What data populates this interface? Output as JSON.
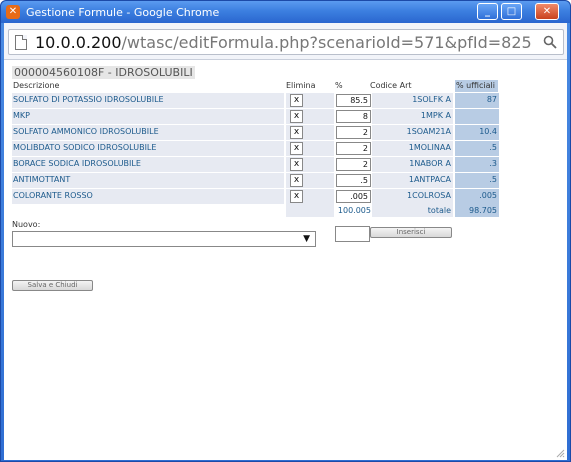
{
  "window": {
    "app_icon": "xampp-icon",
    "title": "Gestione Formule - Google Chrome",
    "minimize_label": "_",
    "maximize_label": "□",
    "close_label": "✕"
  },
  "address": {
    "host": "10.0.0.200",
    "path": "/wtasc/editFormula.php?scenarioId=571&pfId=825"
  },
  "formula": {
    "title": "000004560108F - IDROSOLUBILI",
    "headers": {
      "descrizione": "Descrizione",
      "elimina": "Elimina",
      "percent": "%",
      "codice_art": "Codice Art",
      "percent_ufficiali": "% ufficiali"
    },
    "rows": [
      {
        "descrizione": "SOLFATO DI POTASSIO IDROSOLUBILE",
        "elimina": "x",
        "percent": "85.5",
        "codice": "1SOLFK A",
        "ufficiali": "87"
      },
      {
        "descrizione": "MKP",
        "elimina": "x",
        "percent": "8",
        "codice": "1MPK A",
        "ufficiali": ""
      },
      {
        "descrizione": "SOLFATO AMMONICO IDROSOLUBILE",
        "elimina": "x",
        "percent": "2",
        "codice": "1SOAM21A",
        "ufficiali": "10.4"
      },
      {
        "descrizione": "MOLIBDATO SODICO IDROSOLUBILE",
        "elimina": "x",
        "percent": "2",
        "codice": "1MOLINAA",
        "ufficiali": ".5"
      },
      {
        "descrizione": "BORACE SODICA IDROSOLUBILE",
        "elimina": "x",
        "percent": "2",
        "codice": "1NABOR A",
        "ufficiali": ".3"
      },
      {
        "descrizione": "ANTIMOTTANT",
        "elimina": "x",
        "percent": ".5",
        "codice": "1ANTPACA",
        "ufficiali": ".5"
      },
      {
        "descrizione": "COLORANTE ROSSO",
        "elimina": "x",
        "percent": ".005",
        "codice": "1COLROSA",
        "ufficiali": ".005"
      }
    ],
    "total_percent": "100.005",
    "total_label": "totale",
    "total_ufficiali": "98.705"
  },
  "new_entry": {
    "label": "Nuovo:",
    "selected": "",
    "percent_value": "",
    "insert_label": "Inserisci",
    "dropdown_arrow": "▼"
  },
  "actions": {
    "save_close_label": "Salva e Chiudi"
  }
}
